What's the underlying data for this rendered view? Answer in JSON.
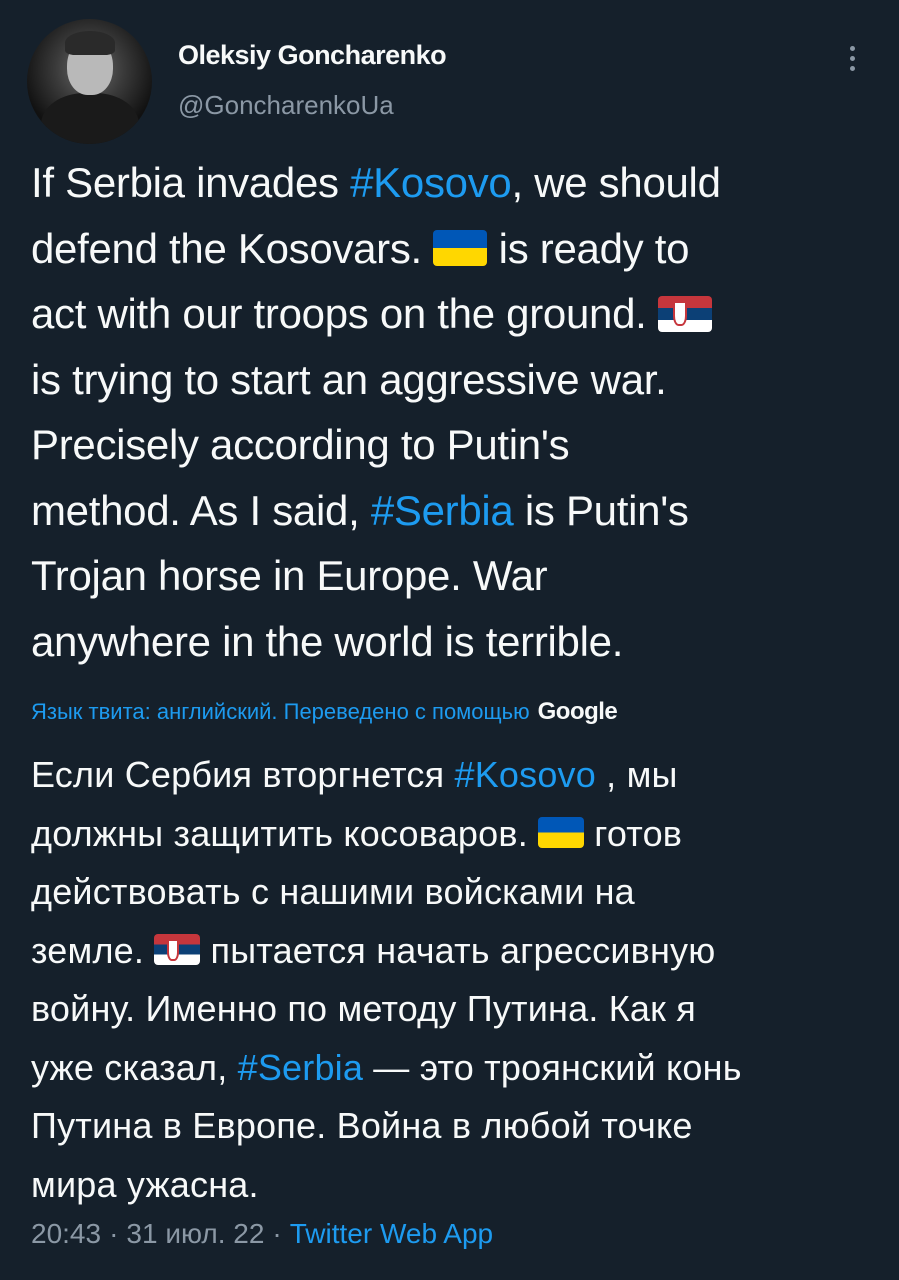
{
  "user": {
    "name": "Oleksiy Goncharenko",
    "handle": "@GoncharenkoUa"
  },
  "tweet": {
    "lines": [
      [
        "If Serbia invades ",
        {
          "hashtag": "#Kosovo"
        },
        ", we should"
      ],
      [
        "defend the Kosovars. ",
        {
          "flag": "ukraine-flag"
        },
        " is ready to"
      ],
      [
        "act with our troops on the ground. ",
        {
          "flag": "serbia-flag"
        }
      ],
      [
        "is trying to start an aggressive war."
      ],
      [
        "Precisely according to Putin's"
      ],
      [
        "method. As I said, ",
        {
          "hashtag": "#Serbia"
        },
        " is Putin's"
      ],
      [
        "Trojan horse in Europe. War"
      ],
      [
        "anywhere in the world is terrible."
      ]
    ]
  },
  "translation": {
    "meta": "Язык твита: английский. Переведено с помощью",
    "provider": "Google",
    "lines": [
      [
        "Если Сербия вторгнется ",
        {
          "hashtag": "#Kosovo"
        },
        " , мы"
      ],
      [
        "должны защитить косоваров. ",
        {
          "flag": "ukraine-flag"
        },
        " готов"
      ],
      [
        "действовать с нашими войсками на"
      ],
      [
        "земле. ",
        {
          "flag": "serbia-flag"
        },
        " пытается начать агрессивную"
      ],
      [
        "войну. Именно по методу Путина. Как я"
      ],
      [
        "уже сказал, ",
        {
          "hashtag": "#Serbia"
        },
        " — это троянский конь"
      ],
      [
        "Путина в Европе. Война в любой точке"
      ],
      [
        "мира ужасна."
      ]
    ]
  },
  "footer": {
    "time": "20:43",
    "separator": "·",
    "date": "31 июл. 22",
    "source": "Twitter Web App"
  },
  "colors": {
    "background": "#15202b",
    "text": "#f7f9f9",
    "secondary": "#8b98a5",
    "accent": "#1d9bf0"
  },
  "icons": {
    "more": "more-vertical-icon",
    "avatar": "avatar"
  }
}
